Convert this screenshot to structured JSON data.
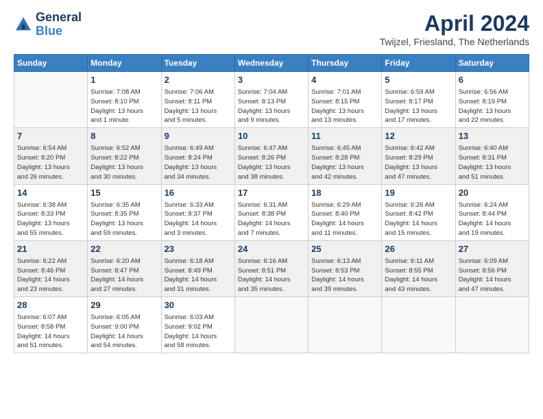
{
  "header": {
    "logo_general": "General",
    "logo_blue": "Blue",
    "title": "April 2024",
    "location": "Twijzel, Friesland, The Netherlands"
  },
  "weekdays": [
    "Sunday",
    "Monday",
    "Tuesday",
    "Wednesday",
    "Thursday",
    "Friday",
    "Saturday"
  ],
  "weeks": [
    [
      {
        "day": "",
        "info": ""
      },
      {
        "day": "1",
        "info": "Sunrise: 7:08 AM\nSunset: 8:10 PM\nDaylight: 13 hours\nand 1 minute."
      },
      {
        "day": "2",
        "info": "Sunrise: 7:06 AM\nSunset: 8:11 PM\nDaylight: 13 hours\nand 5 minutes."
      },
      {
        "day": "3",
        "info": "Sunrise: 7:04 AM\nSunset: 8:13 PM\nDaylight: 13 hours\nand 9 minutes."
      },
      {
        "day": "4",
        "info": "Sunrise: 7:01 AM\nSunset: 8:15 PM\nDaylight: 13 hours\nand 13 minutes."
      },
      {
        "day": "5",
        "info": "Sunrise: 6:59 AM\nSunset: 8:17 PM\nDaylight: 13 hours\nand 17 minutes."
      },
      {
        "day": "6",
        "info": "Sunrise: 6:56 AM\nSunset: 8:19 PM\nDaylight: 13 hours\nand 22 minutes."
      }
    ],
    [
      {
        "day": "7",
        "info": "Sunrise: 6:54 AM\nSunset: 8:20 PM\nDaylight: 13 hours\nand 26 minutes."
      },
      {
        "day": "8",
        "info": "Sunrise: 6:52 AM\nSunset: 8:22 PM\nDaylight: 13 hours\nand 30 minutes."
      },
      {
        "day": "9",
        "info": "Sunrise: 6:49 AM\nSunset: 8:24 PM\nDaylight: 13 hours\nand 34 minutes."
      },
      {
        "day": "10",
        "info": "Sunrise: 6:47 AM\nSunset: 8:26 PM\nDaylight: 13 hours\nand 38 minutes."
      },
      {
        "day": "11",
        "info": "Sunrise: 6:45 AM\nSunset: 8:28 PM\nDaylight: 13 hours\nand 42 minutes."
      },
      {
        "day": "12",
        "info": "Sunrise: 6:42 AM\nSunset: 8:29 PM\nDaylight: 13 hours\nand 47 minutes."
      },
      {
        "day": "13",
        "info": "Sunrise: 6:40 AM\nSunset: 8:31 PM\nDaylight: 13 hours\nand 51 minutes."
      }
    ],
    [
      {
        "day": "14",
        "info": "Sunrise: 6:38 AM\nSunset: 8:33 PM\nDaylight: 13 hours\nand 55 minutes."
      },
      {
        "day": "15",
        "info": "Sunrise: 6:35 AM\nSunset: 8:35 PM\nDaylight: 13 hours\nand 59 minutes."
      },
      {
        "day": "16",
        "info": "Sunrise: 6:33 AM\nSunset: 8:37 PM\nDaylight: 14 hours\nand 3 minutes."
      },
      {
        "day": "17",
        "info": "Sunrise: 6:31 AM\nSunset: 8:38 PM\nDaylight: 14 hours\nand 7 minutes."
      },
      {
        "day": "18",
        "info": "Sunrise: 6:29 AM\nSunset: 8:40 PM\nDaylight: 14 hours\nand 11 minutes."
      },
      {
        "day": "19",
        "info": "Sunrise: 6:26 AM\nSunset: 8:42 PM\nDaylight: 14 hours\nand 15 minutes."
      },
      {
        "day": "20",
        "info": "Sunrise: 6:24 AM\nSunset: 8:44 PM\nDaylight: 14 hours\nand 19 minutes."
      }
    ],
    [
      {
        "day": "21",
        "info": "Sunrise: 6:22 AM\nSunset: 8:46 PM\nDaylight: 14 hours\nand 23 minutes."
      },
      {
        "day": "22",
        "info": "Sunrise: 6:20 AM\nSunset: 8:47 PM\nDaylight: 14 hours\nand 27 minutes."
      },
      {
        "day": "23",
        "info": "Sunrise: 6:18 AM\nSunset: 8:49 PM\nDaylight: 14 hours\nand 31 minutes."
      },
      {
        "day": "24",
        "info": "Sunrise: 6:16 AM\nSunset: 8:51 PM\nDaylight: 14 hours\nand 35 minutes."
      },
      {
        "day": "25",
        "info": "Sunrise: 6:13 AM\nSunset: 8:53 PM\nDaylight: 14 hours\nand 39 minutes."
      },
      {
        "day": "26",
        "info": "Sunrise: 6:11 AM\nSunset: 8:55 PM\nDaylight: 14 hours\nand 43 minutes."
      },
      {
        "day": "27",
        "info": "Sunrise: 6:09 AM\nSunset: 8:56 PM\nDaylight: 14 hours\nand 47 minutes."
      }
    ],
    [
      {
        "day": "28",
        "info": "Sunrise: 6:07 AM\nSunset: 8:58 PM\nDaylight: 14 hours\nand 51 minutes."
      },
      {
        "day": "29",
        "info": "Sunrise: 6:05 AM\nSunset: 9:00 PM\nDaylight: 14 hours\nand 54 minutes."
      },
      {
        "day": "30",
        "info": "Sunrise: 6:03 AM\nSunset: 9:02 PM\nDaylight: 14 hours\nand 58 minutes."
      },
      {
        "day": "",
        "info": ""
      },
      {
        "day": "",
        "info": ""
      },
      {
        "day": "",
        "info": ""
      },
      {
        "day": "",
        "info": ""
      }
    ]
  ]
}
